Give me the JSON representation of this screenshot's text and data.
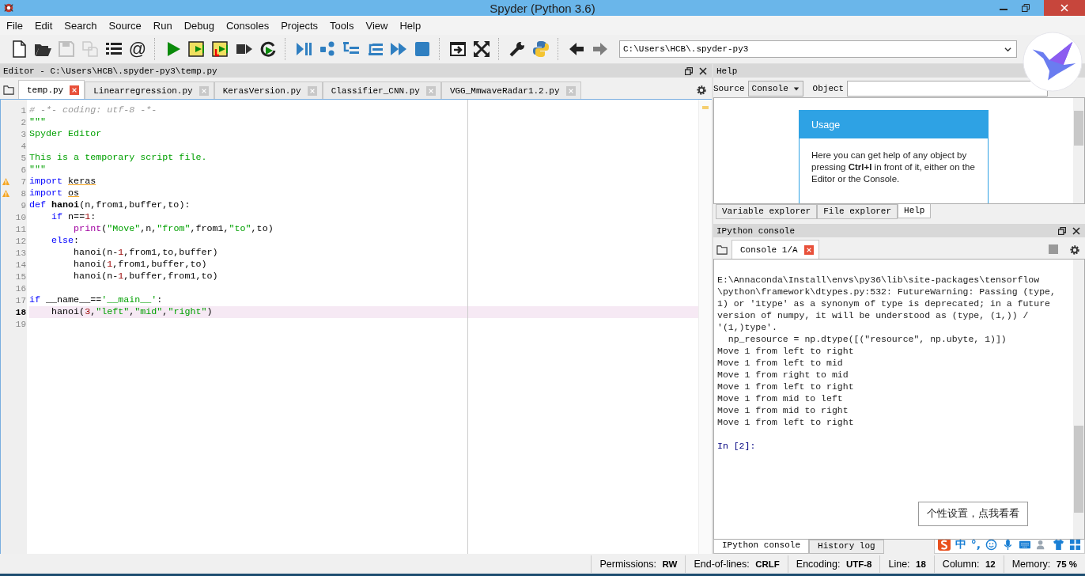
{
  "window": {
    "title": "Spyder (Python 3.6)"
  },
  "menu": [
    "File",
    "Edit",
    "Search",
    "Source",
    "Run",
    "Debug",
    "Consoles",
    "Projects",
    "Tools",
    "View",
    "Help"
  ],
  "toolbar": [
    {
      "kind": "new-file",
      "disabled": false
    },
    {
      "kind": "open",
      "disabled": false
    },
    {
      "kind": "save",
      "disabled": true
    },
    {
      "kind": "save-all",
      "disabled": true
    },
    {
      "kind": "list",
      "disabled": false
    },
    {
      "kind": "at",
      "disabled": false
    },
    {
      "kind": "sep"
    },
    {
      "kind": "run",
      "disabled": false
    },
    {
      "kind": "run-cell",
      "disabled": false
    },
    {
      "kind": "run-cell-advance",
      "disabled": false
    },
    {
      "kind": "run-selection",
      "disabled": false
    },
    {
      "kind": "rerun",
      "disabled": false
    },
    {
      "kind": "sep"
    },
    {
      "kind": "debug",
      "disabled": false
    },
    {
      "kind": "step",
      "disabled": false
    },
    {
      "kind": "step-into",
      "disabled": false
    },
    {
      "kind": "step-return",
      "disabled": false
    },
    {
      "kind": "continue",
      "disabled": false
    },
    {
      "kind": "stop",
      "disabled": false
    },
    {
      "kind": "sep"
    },
    {
      "kind": "maximize",
      "disabled": false
    },
    {
      "kind": "fullscreen",
      "disabled": false
    },
    {
      "kind": "sep"
    },
    {
      "kind": "wrench",
      "disabled": false
    },
    {
      "kind": "python",
      "disabled": false
    },
    {
      "kind": "sep"
    },
    {
      "kind": "back",
      "disabled": false
    },
    {
      "kind": "forward",
      "disabled": true
    }
  ],
  "at_symbol": "@",
  "path_field": {
    "value": "C:\\Users\\HCB\\.spyder-py3"
  },
  "editor": {
    "title": "Editor - C:\\Users\\HCB\\.spyder-py3\\temp.py",
    "tabs": [
      {
        "label": "temp.py",
        "selected": true
      },
      {
        "label": "Linearregression.py",
        "selected": false
      },
      {
        "label": "KerasVersion.py",
        "selected": false
      },
      {
        "label": "Classifier_CNN.py",
        "selected": false
      },
      {
        "label": "VGG_MmwaveRadar1.2.py",
        "selected": false
      }
    ],
    "lines": [
      {
        "n": "1",
        "warning": false,
        "current": false,
        "tokens": [
          {
            "kind": "cmt",
            "text": "# -*- coding: utf-8 -*-"
          }
        ]
      },
      {
        "n": "2",
        "warning": false,
        "current": false,
        "tokens": [
          {
            "kind": "str",
            "text": "\"\"\""
          }
        ]
      },
      {
        "n": "3",
        "warning": false,
        "current": false,
        "tokens": [
          {
            "kind": "str",
            "text": "Spyder Editor"
          }
        ]
      },
      {
        "n": "4",
        "warning": false,
        "current": false
      },
      {
        "n": "5",
        "warning": false,
        "current": false,
        "tokens": [
          {
            "kind": "str",
            "text": "This is a temporary script file."
          }
        ]
      },
      {
        "n": "6",
        "warning": false,
        "current": false,
        "tokens": [
          {
            "kind": "str",
            "text": "\"\"\""
          }
        ]
      },
      {
        "n": "7",
        "warning": true,
        "current": false,
        "tokens": [
          {
            "kind": "kw",
            "text": "import "
          },
          {
            "kind": "warn",
            "text": "keras"
          }
        ]
      },
      {
        "n": "8",
        "warning": true,
        "current": false,
        "tokens": [
          {
            "kind": "kw",
            "text": "import "
          },
          {
            "kind": "warn",
            "text": "os"
          }
        ]
      },
      {
        "n": "9",
        "warning": false,
        "current": false,
        "tokens": [
          {
            "kind": "kw",
            "text": "def "
          },
          {
            "kind": "def",
            "text": "hanoi"
          },
          {
            "kind": "plain",
            "text": "(n,from1,buffer,to):"
          }
        ]
      },
      {
        "n": "10",
        "warning": false,
        "current": false,
        "tokens": [
          {
            "kind": "kw",
            "text": "    if"
          },
          {
            "kind": "plain",
            "text": " n=="
          },
          {
            "kind": "num",
            "text": "1"
          },
          {
            "kind": "plain",
            "text": ":"
          }
        ]
      },
      {
        "n": "11",
        "warning": false,
        "current": false,
        "tokens": [
          {
            "kind": "builtin",
            "text": "        print"
          },
          {
            "kind": "plain",
            "text": "("
          },
          {
            "kind": "str",
            "text": "\"Move\""
          },
          {
            "kind": "plain",
            "text": ",n,"
          },
          {
            "kind": "str",
            "text": "\"from\""
          },
          {
            "kind": "plain",
            "text": ",from1,"
          },
          {
            "kind": "str",
            "text": "\"to\""
          },
          {
            "kind": "plain",
            "text": ",to)"
          }
        ]
      },
      {
        "n": "12",
        "warning": false,
        "current": false,
        "tokens": [
          {
            "kind": "kw",
            "text": "    else"
          },
          {
            "kind": "plain",
            "text": ":"
          }
        ]
      },
      {
        "n": "13",
        "warning": false,
        "current": false,
        "tokens": [
          {
            "kind": "plain",
            "text": "        hanoi(n-"
          },
          {
            "kind": "num",
            "text": "1"
          },
          {
            "kind": "plain",
            "text": ",from1,to,buffer)"
          }
        ]
      },
      {
        "n": "14",
        "warning": false,
        "current": false,
        "tokens": [
          {
            "kind": "plain",
            "text": "        hanoi("
          },
          {
            "kind": "num",
            "text": "1"
          },
          {
            "kind": "plain",
            "text": ",from1,buffer,to)"
          }
        ]
      },
      {
        "n": "15",
        "warning": false,
        "current": false,
        "tokens": [
          {
            "kind": "plain",
            "text": "        hanoi(n-"
          },
          {
            "kind": "num",
            "text": "1"
          },
          {
            "kind": "plain",
            "text": ",buffer,from1,to)"
          }
        ]
      },
      {
        "n": "16",
        "warning": false,
        "current": false
      },
      {
        "n": "17",
        "warning": false,
        "current": false,
        "tokens": [
          {
            "kind": "kw",
            "text": "if"
          },
          {
            "kind": "plain",
            "text": " __name__=="
          },
          {
            "kind": "str",
            "text": "'__main__'"
          },
          {
            "kind": "plain",
            "text": ":"
          }
        ]
      },
      {
        "n": "18",
        "warning": false,
        "current": true,
        "tokens": [
          {
            "kind": "plain",
            "text": "    hanoi("
          },
          {
            "kind": "num",
            "text": "3"
          },
          {
            "kind": "plain",
            "text": ","
          },
          {
            "kind": "str",
            "text": "\"left\""
          },
          {
            "kind": "plain",
            "text": ","
          },
          {
            "kind": "str",
            "text": "\"mid\""
          },
          {
            "kind": "plain",
            "text": ","
          },
          {
            "kind": "str",
            "text": "\"right\""
          },
          {
            "kind": "plain",
            "text": ")"
          }
        ]
      },
      {
        "n": "19",
        "warning": false,
        "current": false
      }
    ]
  },
  "help": {
    "title": "Help",
    "source_label": "Source",
    "source_value": "Console",
    "object_label": "Object",
    "usage_title": "Usage",
    "usage_text": "Here you can get help of any object by pressing **Ctrl+I** in front of it, either on the Editor or the Console.",
    "tabs": [
      {
        "label": "Variable explorer",
        "selected": false
      },
      {
        "label": "File explorer",
        "selected": false
      },
      {
        "label": "Help",
        "selected": true
      }
    ]
  },
  "console": {
    "title": "IPython console",
    "tabs": [
      {
        "label": "Console 1/A",
        "selected": true
      }
    ],
    "output": [
      "E:\\Annaconda\\Install\\envs\\py36\\lib\\site-packages\\tensorflow",
      "\\python\\framework\\dtypes.py:532: FutureWarning: Passing (type,",
      "1) or '1type' as a synonym of type is deprecated; in a future",
      "version of numpy, it will be understood as (type, (1,)) /",
      "'(1,)type'.",
      "  np_resource = np.dtype([(\"resource\", np.ubyte, 1)])",
      "Move 1 from left to right",
      "Move 1 from left to mid",
      "Move 1 from right to mid",
      "Move 1 from left to right",
      "Move 1 from mid to left",
      "Move 1 from mid to right",
      "Move 1 from left to right"
    ],
    "prompt": "In [2]:",
    "bottom_tabs": [
      {
        "label": "IPython console",
        "selected": true
      },
      {
        "label": "History log",
        "selected": false
      }
    ]
  },
  "ime": {
    "tooltip": "个性设置，点我看看",
    "mode": "中",
    "punct": "°,"
  },
  "status_bar": [
    {
      "label": "Permissions:",
      "value": "RW"
    },
    {
      "label": "End-of-lines:",
      "value": "CRLF"
    },
    {
      "label": "Encoding:",
      "value": "UTF-8"
    },
    {
      "label": "Line:",
      "value": "18"
    },
    {
      "label": "Column:",
      "value": "12"
    },
    {
      "label": "Memory:",
      "value": "75 %"
    }
  ]
}
